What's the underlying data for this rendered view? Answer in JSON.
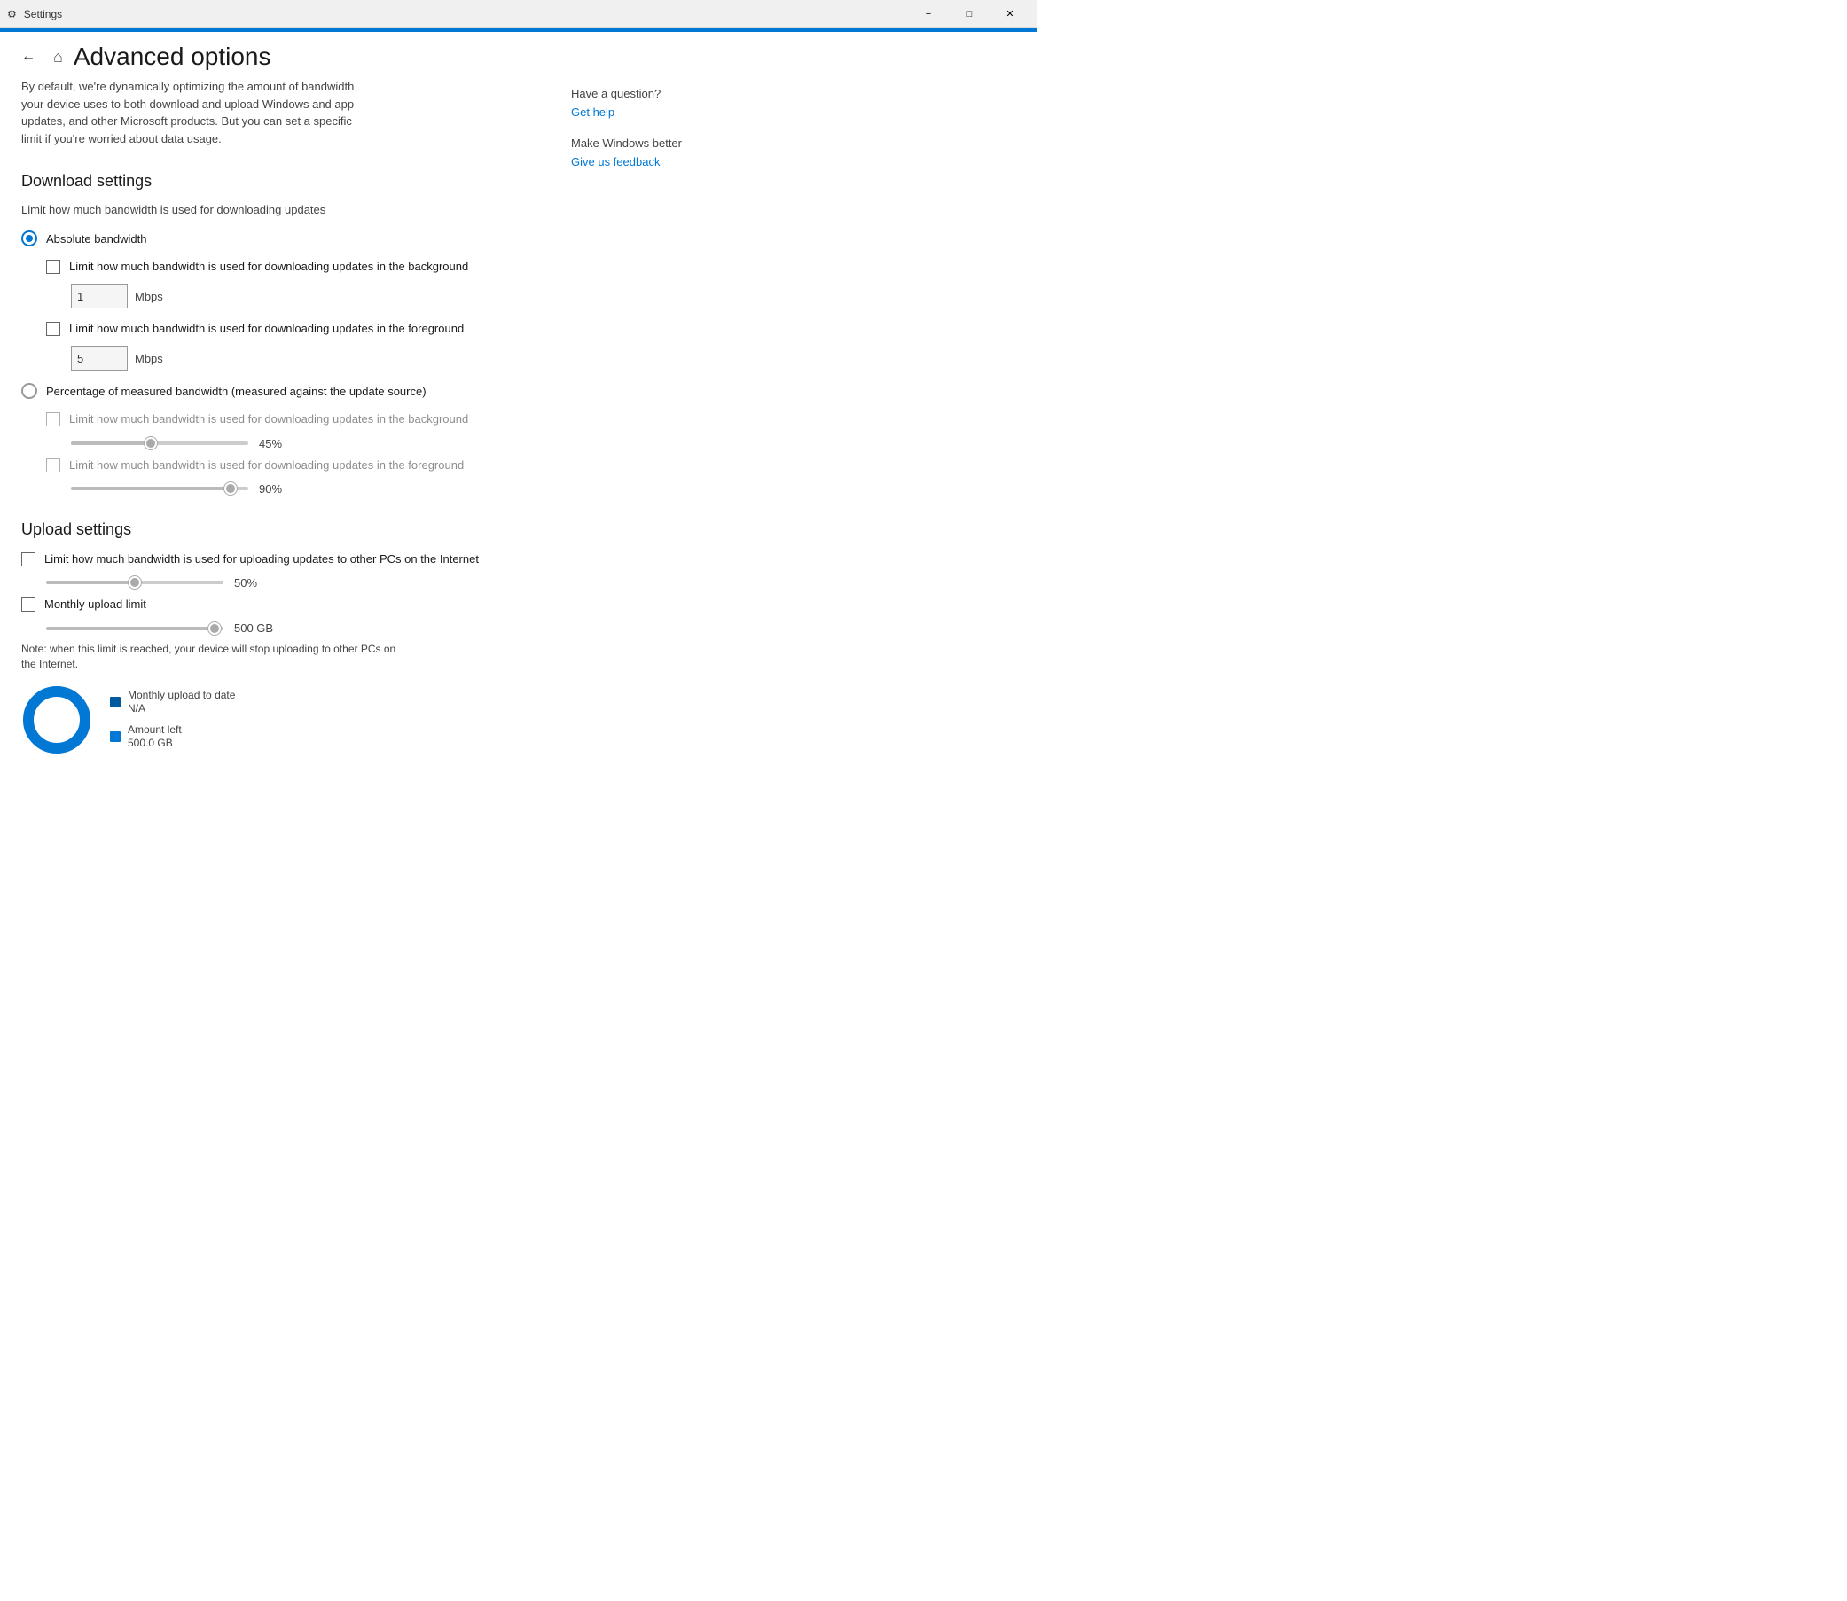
{
  "titlebar": {
    "title": "Settings",
    "minimize_label": "−",
    "restore_label": "□",
    "close_label": "✕"
  },
  "header": {
    "back_button": "←",
    "home_icon": "⌂",
    "page_title": "Advanced options"
  },
  "description": "By default, we're dynamically optimizing the amount of bandwidth your device uses to both download and upload Windows and app updates, and other Microsoft products. But you can set a specific limit if you're worried about data usage.",
  "download_settings": {
    "heading": "Download settings",
    "subtext": "Limit how much bandwidth is used for downloading updates",
    "radio_absolute_label": "Absolute bandwidth",
    "radio_absolute_selected": true,
    "checkbox_background_label": "Limit how much bandwidth is used for downloading updates in the background",
    "background_value": "1",
    "background_unit": "Mbps",
    "checkbox_foreground_label": "Limit how much bandwidth is used for downloading updates in the foreground",
    "foreground_value": "5",
    "foreground_unit": "Mbps",
    "radio_percentage_label": "Percentage of measured bandwidth (measured against the update source)",
    "radio_percentage_selected": false,
    "pct_bg_checkbox_label": "Limit how much bandwidth is used for downloading updates in the background",
    "pct_bg_value": "45%",
    "pct_bg_fill_pct": 45,
    "pct_fg_checkbox_label": "Limit how much bandwidth is used for downloading updates in the foreground",
    "pct_fg_value": "90%",
    "pct_fg_fill_pct": 90
  },
  "upload_settings": {
    "heading": "Upload settings",
    "checkbox_upload_label": "Limit how much bandwidth is used for uploading updates to other PCs on the Internet",
    "upload_slider_value": "50%",
    "upload_slider_fill_pct": 50,
    "checkbox_monthly_label": "Monthly upload limit",
    "monthly_slider_value": "500 GB",
    "monthly_slider_fill_pct": 95,
    "note_text": "Note: when this limit is reached, your device will stop uploading to other PCs on the Internet.",
    "legend_monthly_label": "Monthly upload to date",
    "legend_monthly_value": "N/A",
    "legend_amount_label": "Amount left",
    "legend_amount_value": "500.0 GB",
    "donut_used_pct": 0,
    "donut_left_pct": 100,
    "donut_color_used": "#005a9e",
    "donut_color_left": "#0078d4"
  },
  "sidebar": {
    "question_label": "Have a question?",
    "get_help_link": "Get help",
    "make_windows_label": "Make Windows better",
    "feedback_link": "Give us feedback"
  }
}
